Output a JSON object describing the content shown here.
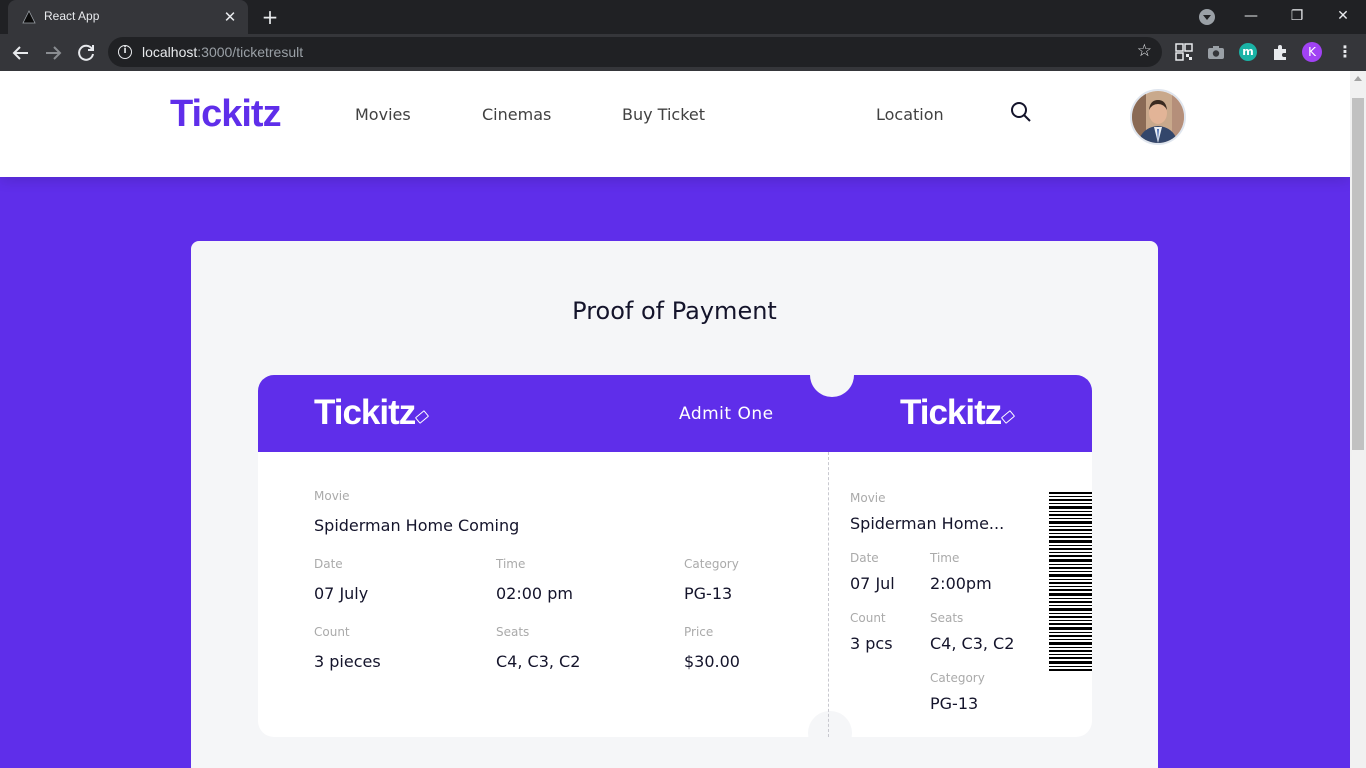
{
  "browser": {
    "tab_title": "React App",
    "url_host": "localhost",
    "url_rest": ":3000/ticketresult",
    "profile_initial": "K",
    "extension_m": "m"
  },
  "header": {
    "brand": "Tickitz",
    "nav": [
      "Movies",
      "Cinemas",
      "Buy Ticket",
      "Location"
    ]
  },
  "page": {
    "title": "Proof of Payment"
  },
  "ticket": {
    "brand": "Tickitz",
    "admit": "Admit One",
    "main": {
      "movie_label": "Movie",
      "movie": "Spiderman Home Coming",
      "date_label": "Date",
      "date": "07 July",
      "time_label": "Time",
      "time": "02:00 pm",
      "category_label": "Category",
      "category": "PG-13",
      "count_label": "Count",
      "count": "3 pieces",
      "seats_label": "Seats",
      "seats": "C4, C3, C2",
      "price_label": "Price",
      "price": "$30.00"
    },
    "stub": {
      "movie_label": "Movie",
      "movie": "Spiderman Home...",
      "date_label": "Date",
      "date": "07 Jul",
      "time_label": "Time",
      "time": "2:00pm",
      "count_label": "Count",
      "count": "3 pcs",
      "seats_label": "Seats",
      "seats": "C4, C3, C2",
      "category_label": "Category",
      "category": "PG-13"
    }
  },
  "colors": {
    "brand_purple": "#5f2eea",
    "card_bg": "#f5f6f8"
  }
}
